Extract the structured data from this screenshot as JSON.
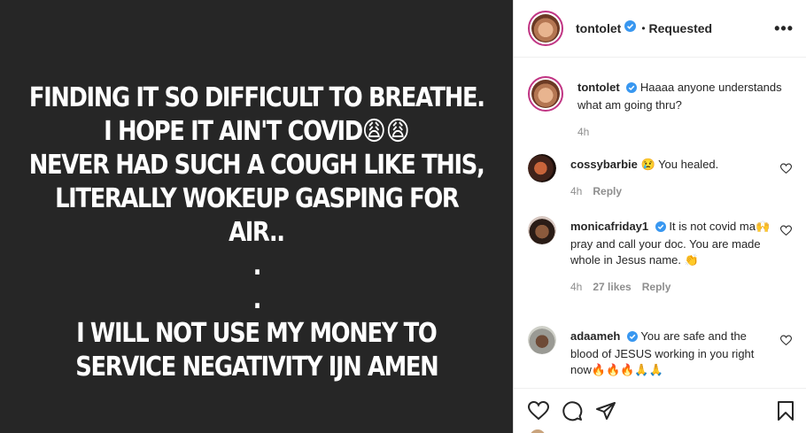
{
  "post": {
    "lines": [
      {
        "text": "FINDING IT SO DIFFICULT TO BREATHE."
      },
      {
        "text": "I HOPE IT AIN'T COVID",
        "emoji": "😩😩"
      },
      {
        "text": "NEVER HAD SUCH A COUGH LIKE THIS,"
      },
      {
        "text": "LITERALLY WOKEUP GASPING FOR"
      },
      {
        "text": "AIR.."
      },
      {
        "text": "."
      },
      {
        "text": "."
      },
      {
        "text": "I WILL NOT USE MY MONEY TO"
      },
      {
        "text": "SERVICE NEGATIVITY IJN AMEN"
      }
    ]
  },
  "header": {
    "username": "tontolet",
    "separator": "•",
    "follow_status": "Requested",
    "more_label": "•••"
  },
  "caption": {
    "username": "tontolet",
    "text": "Haaaa anyone understands what am going thru?",
    "time": "4h"
  },
  "comments": [
    {
      "username": "cossybarbie",
      "verified": false,
      "text": "😢 You healed.",
      "time": "4h",
      "likes": "",
      "reply": "Reply"
    },
    {
      "username": "monicafriday1",
      "verified": true,
      "text": "It is not covid ma🙌 pray and call your doc. You are made whole in Jesus name. 👏",
      "time": "4h",
      "likes": "27 likes",
      "reply": "Reply"
    },
    {
      "username": "adaameh",
      "verified": true,
      "text": "You are safe and the blood of JESUS working in you right now🔥🔥🔥🙏🙏",
      "time": "",
      "likes": "",
      "reply": ""
    }
  ],
  "icons": {
    "verified": "verified-badge-icon",
    "heart": "heart-icon",
    "comment": "comment-icon",
    "share": "share-icon",
    "save": "bookmark-icon"
  },
  "colors": {
    "verified_blue": "#3897f0",
    "story_ring": "#c13584",
    "post_bg": "#262626"
  }
}
